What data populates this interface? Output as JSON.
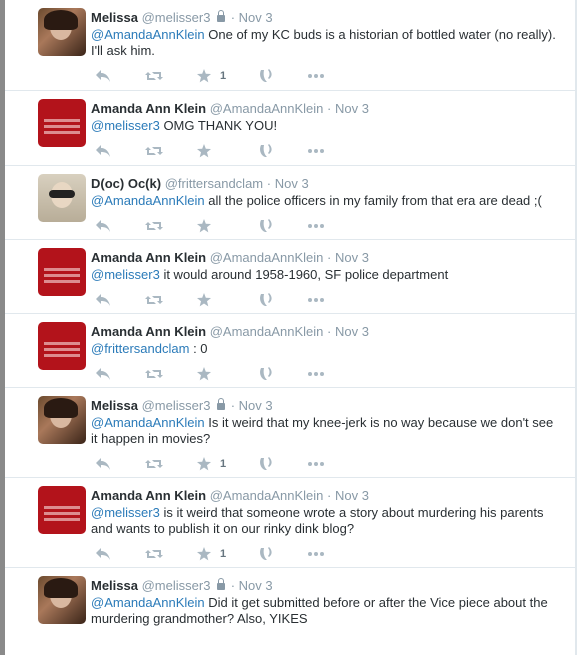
{
  "tweets": [
    {
      "avatar": "melissa",
      "name": "Melissa",
      "handle": "@melisser3",
      "protected": true,
      "time": "Nov 3",
      "mention": "@AmandaAnnKlein",
      "text": " One of my KC buds is a historian of bottled water (no really). I'll ask him.",
      "favorites": "1"
    },
    {
      "avatar": "amanda",
      "name": "Amanda Ann Klein",
      "handle": "@AmandaAnnKlein",
      "protected": false,
      "time": "Nov 3",
      "mention": "@melisser3",
      "text": " OMG THANK YOU!",
      "favorites": ""
    },
    {
      "avatar": "doc",
      "name": "D(oc) Oc(k)",
      "handle": "@frittersandclam",
      "protected": false,
      "time": "Nov 3",
      "mention": "@AmandaAnnKlein",
      "text": " all the police officers in my family from that era are dead ;(",
      "favorites": ""
    },
    {
      "avatar": "amanda",
      "name": "Amanda Ann Klein",
      "handle": "@AmandaAnnKlein",
      "protected": false,
      "time": "Nov 3",
      "mention": "@melisser3",
      "text": " it would around 1958-1960, SF police department",
      "favorites": ""
    },
    {
      "avatar": "amanda",
      "name": "Amanda Ann Klein",
      "handle": "@AmandaAnnKlein",
      "protected": false,
      "time": "Nov 3",
      "mention": "@frittersandclam",
      "text": " : 0",
      "favorites": ""
    },
    {
      "avatar": "melissa",
      "name": "Melissa",
      "handle": "@melisser3",
      "protected": true,
      "time": "Nov 3",
      "mention": "@AmandaAnnKlein",
      "text": " Is it weird that my knee-jerk is no way because we don't see it happen in movies?",
      "favorites": "1"
    },
    {
      "avatar": "amanda",
      "name": "Amanda Ann Klein",
      "handle": "@AmandaAnnKlein",
      "protected": false,
      "time": "Nov 3",
      "mention": "@melisser3",
      "text": " is it weird that someone wrote a story about murdering his parents and wants to publish it on our rinky dink blog?",
      "favorites": "1"
    },
    {
      "avatar": "melissa",
      "name": "Melissa",
      "handle": "@melisser3",
      "protected": true,
      "time": "Nov 3",
      "mention": "@AmandaAnnKlein",
      "text": " Did it get submitted before or after the Vice piece about the murdering grandmother? Also, YIKES",
      "favorites": ""
    }
  ],
  "separator": "·",
  "icons": {
    "reply": "reply-icon",
    "retweet": "retweet-icon",
    "favorite": "star-icon",
    "vine": "vine-icon",
    "more": "more-icon",
    "lock": "lock-icon"
  },
  "colors": {
    "link": "#2b7bb9",
    "muted": "#8899a6",
    "action": "#aab8c2",
    "border": "#e1e8ed",
    "amanda_avatar": "#b3131b"
  }
}
